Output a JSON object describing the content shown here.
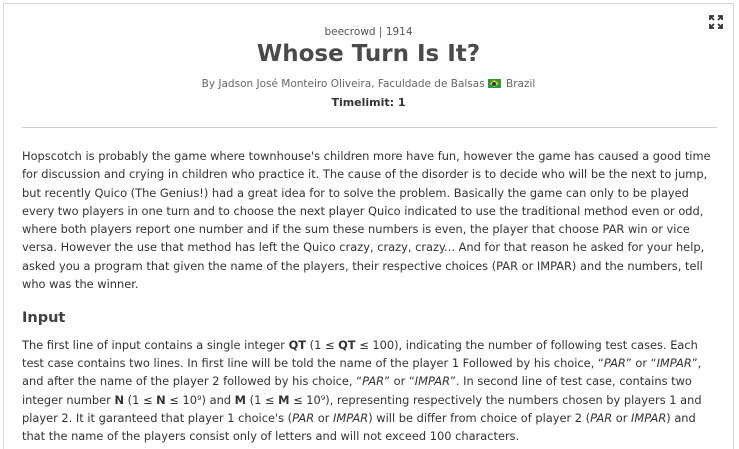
{
  "meta": {
    "source": "beecrowd",
    "separator": "|",
    "problem_id": "1914"
  },
  "title": "Whose Turn Is It?",
  "author": {
    "prefix": "By",
    "name": "Jadson José Monteiro Oliveira, Faculdade de Balsas",
    "country": "Brazil"
  },
  "timelimit": "Timelimit: 1",
  "description": "Hopscotch is probably the game where townhouse's children more have fun, however the game has caused a good time for discussion and crying in children who practice it. The cause of the disorder is to decide who will be the next to jump, but recently Quico (The Genius!) had a great idea for to solve the problem. Basically the game can only to be played every two players in one turn and to choose the next player Quico indicated to use the traditional method even or odd, where both players report one number and if the sum these numbers is even, the player that choose PAR win or vice versa. However the use that method has left the Quico crazy, crazy, crazy... And for that reason he asked for your help, asked you a program that given the name of the players, their respective choices (PAR or IMPAR) and the numbers, tell who was the winner.",
  "input_section": {
    "heading": "Input",
    "p1_a": "The first line of input contains a single integer ",
    "qt": "QT",
    "p1_b": " (1 ≤ ",
    "p1_c": " ≤ 100), indicating the number of following test cases. Each test case contains two lines. In first line will be told the name of the player 1 Followed by his choice, “",
    "par": "PAR",
    "p1_d": "” or “",
    "impar": "IMPAR",
    "p1_e": "”, and after the name of the player 2 followed by his choice, “",
    "p1_f": "”. In second line of test case, contains two integer number ",
    "n": "N",
    "p1_g": " (1 ≤ ",
    "p1_h": " ≤ 10⁹) and ",
    "m": "M",
    "p1_i": " ≤ 10⁹), representing respectively the numbers chosen by players 1 and player 2. It it garanteed that player 1 choice's (",
    "or": " or ",
    "p1_j": ") will be differ from choice of player 2 (",
    "p1_k": ") and that the name of the players consist only of letters and will not exceed 100 characters."
  }
}
